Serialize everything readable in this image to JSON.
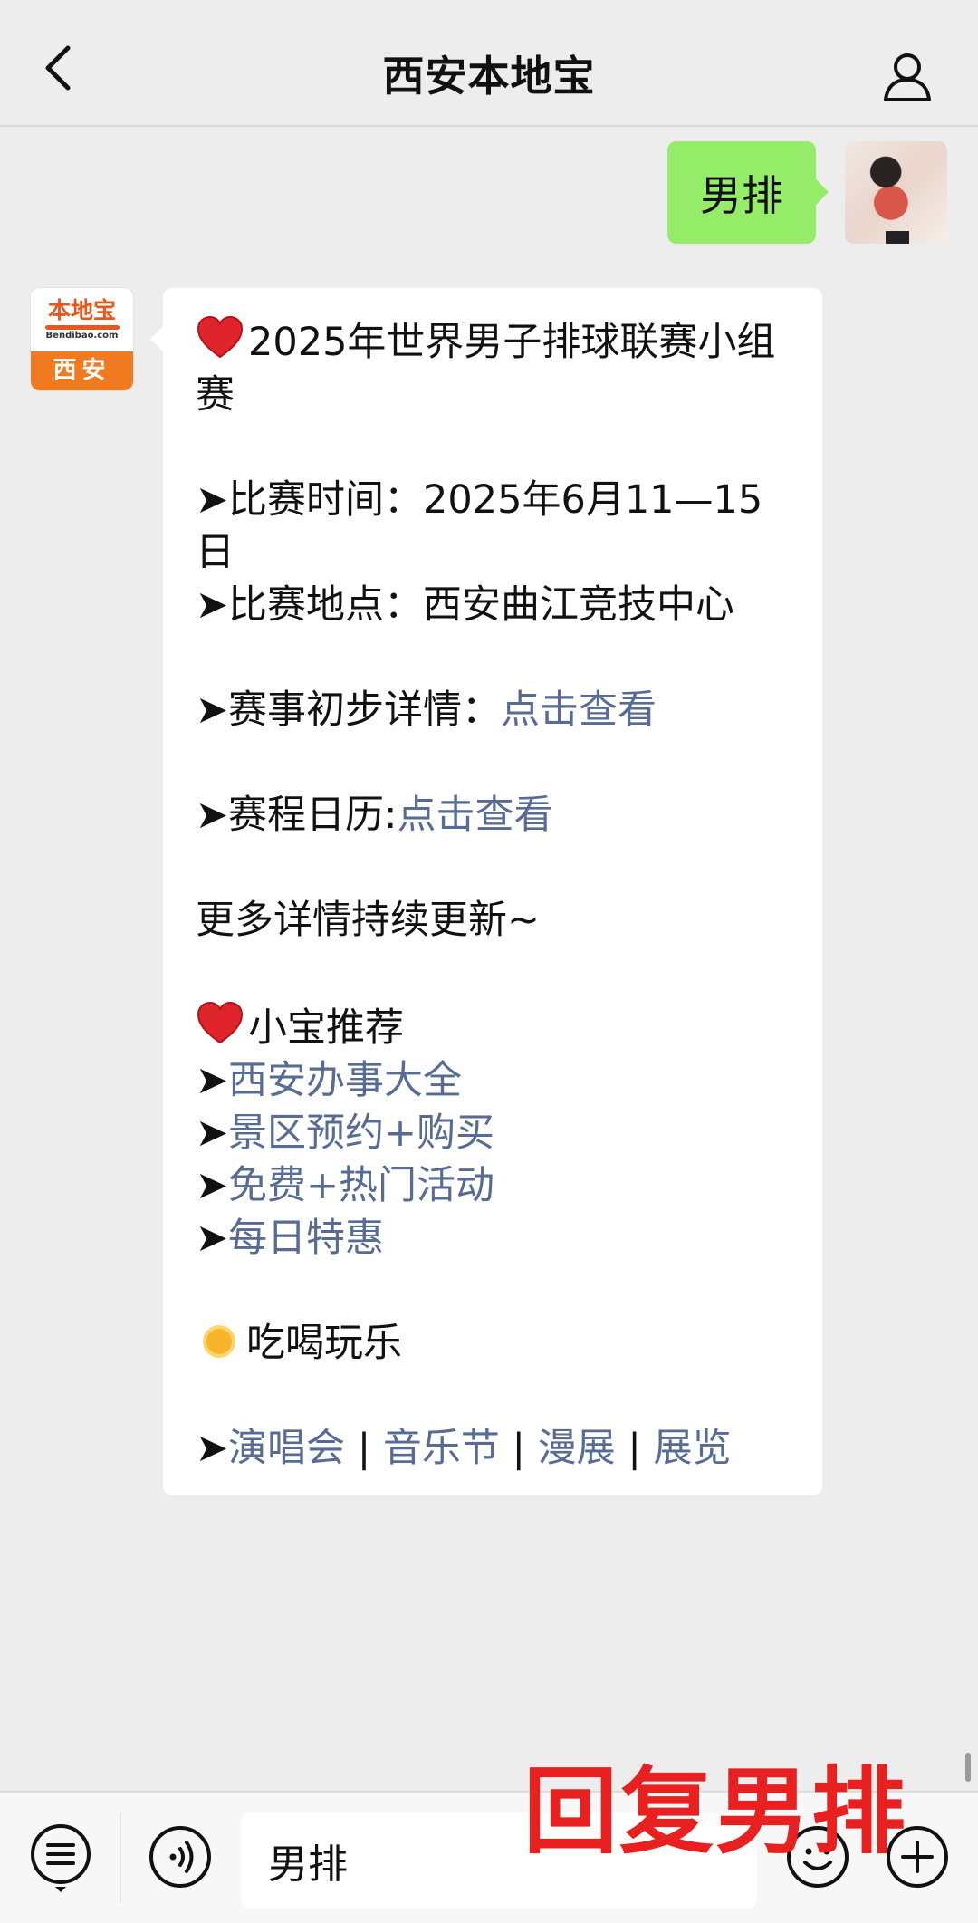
{
  "header": {
    "title": "西安本地宝",
    "back_icon": "chevron-left-icon",
    "profile_icon": "person-icon"
  },
  "outgoing": {
    "text": "男排"
  },
  "brand": {
    "logo_text": "本地宝",
    "logo_sub": "Bendibao.com",
    "city": "西安"
  },
  "message": {
    "title": "2025年世界男子排球联赛小组赛",
    "time_label": "➤比赛时间：2025年6月11—15日",
    "venue_label": "➤比赛地点：西安曲江竞技中心",
    "details_prefix": "➤赛事初步详情：",
    "details_link": "点击查看",
    "calendar_prefix": "➤赛程日历:",
    "calendar_link": "点击查看",
    "more_updates": "更多详情持续更新~",
    "recommend_title": "小宝推荐",
    "rec_items": [
      {
        "prefix": "➤",
        "link": "西安办事大全"
      },
      {
        "prefix": "➤",
        "link": "景区预约+购买"
      },
      {
        "prefix": "➤",
        "link": "免费+热门活动"
      },
      {
        "prefix": "➤",
        "link": "每日特惠"
      }
    ],
    "fun_title": "吃喝玩乐",
    "fun_prefix": "➤",
    "fun_links": [
      "演唱会",
      "音乐节",
      "漫展",
      "展览"
    ],
    "separator": " | "
  },
  "overlay": {
    "text": "回复男排"
  },
  "input_bar": {
    "value": "男排",
    "menu_icon": "list-menu-icon",
    "voice_icon": "voice-icon",
    "emoji_icon": "smiley-icon",
    "plus_icon": "plus-icon"
  },
  "colors": {
    "link": "#576b95",
    "outgoing_bubble": "#95ec69",
    "overlay": "#e8201f",
    "brand_orange": "#ef7a1f"
  }
}
